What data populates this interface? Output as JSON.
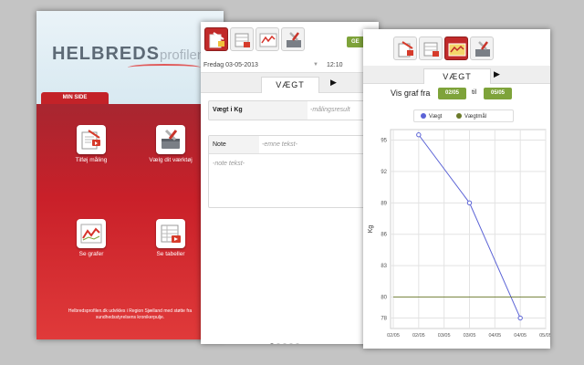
{
  "home": {
    "logo_main": "HELBREDS",
    "logo_sub": "profilen.dk",
    "tab_label": "MIN SIDE",
    "items": [
      {
        "label": "Tilføj måling",
        "icon": "add-measurement-icon"
      },
      {
        "label": "Vælg dit værktøj",
        "icon": "toolbox-icon"
      },
      {
        "label": "Se grafer",
        "icon": "line-graph-icon"
      },
      {
        "label": "Se tabeller",
        "icon": "table-icon"
      }
    ],
    "footer": "Helbredsprofilen.dk udvikles i Region Sjælland med støtte fra sundhedsstyrelsens kronikerpulje."
  },
  "entry": {
    "save_label": "GE",
    "date": "Fredag 03-05-2013",
    "time": "12:10",
    "tab_label": "VÆGT",
    "weight_label": "Vægt i Kg",
    "weight_placeholder": "-målingsresult",
    "note_label": "Note",
    "note_subject_placeholder": "-emne tekst-",
    "note_text_placeholder": "-note tekst-"
  },
  "graph": {
    "tab_label": "VÆGT",
    "vis_graf_label": "Vis graf fra",
    "from_date": "02/05",
    "til_label": "til",
    "to_date": "05/05",
    "legend": [
      {
        "name": "Vægt",
        "color": "#5b63d6"
      },
      {
        "name": "Vægtmål",
        "color": "#6b7a2a"
      }
    ]
  },
  "chart_data": {
    "type": "line",
    "ylabel": "Kg",
    "ylim": [
      77,
      96
    ],
    "yticks": [
      95,
      92,
      89,
      86,
      83,
      80,
      78
    ],
    "xticks": [
      "02/05",
      "02/05",
      "03/05",
      "03/05",
      "04/05",
      "04/05",
      "05/05"
    ],
    "series": [
      {
        "name": "Vægt",
        "x": [
          1,
          3,
          5
        ],
        "values": [
          95.5,
          89,
          78
        ]
      },
      {
        "name": "Vægtmål",
        "x": [
          0,
          6
        ],
        "values": [
          80,
          80
        ]
      }
    ]
  },
  "colors": {
    "brand_red": "#c32228",
    "accent_green": "#7ea33a",
    "series_blue": "#5b63d6",
    "goal_olive": "#6b7a2a"
  }
}
